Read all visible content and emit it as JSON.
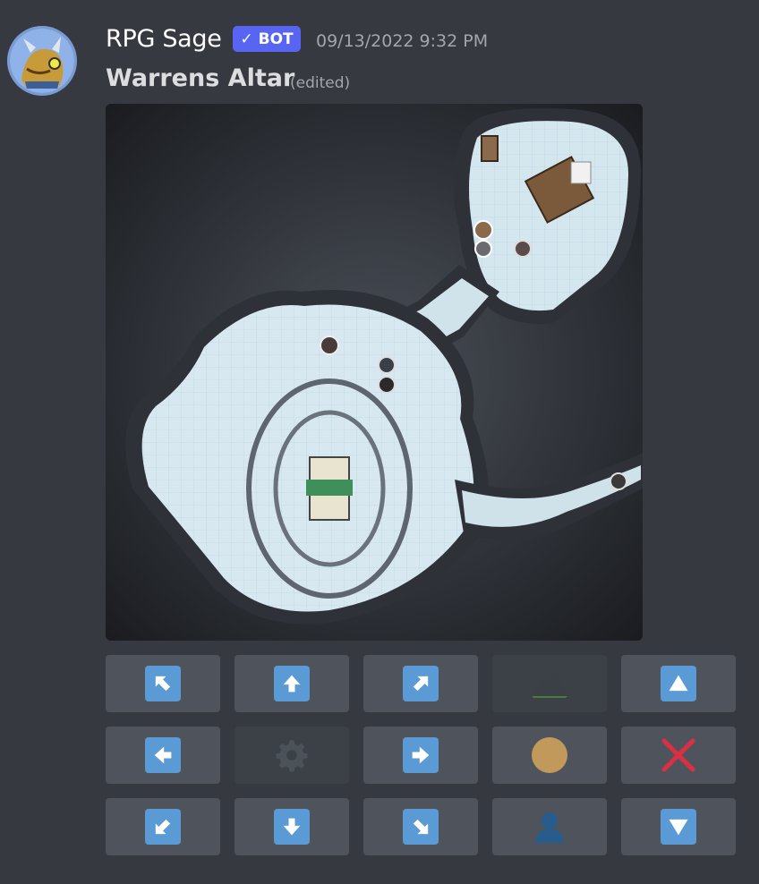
{
  "message": {
    "username": "RPG Sage",
    "bot_tag": "BOT",
    "timestamp": "09/13/2022 9:32 PM",
    "title": "Warrens Altar",
    "edited_label": "(edited)"
  },
  "colors": {
    "bot_tag": "#5865f2",
    "button": "#4f545c",
    "button_disabled": "#3c4047",
    "arrow_box": "#5b9bd5",
    "cancel_red": "#dd2e44",
    "token_circle": "#c19a5b"
  },
  "buttons": [
    {
      "name": "move-up-left-button",
      "icon": "arrow-up-left-icon"
    },
    {
      "name": "move-up-button",
      "icon": "arrow-up-icon"
    },
    {
      "name": "move-up-right-button",
      "icon": "arrow-up-right-icon"
    },
    {
      "name": "terrain-button",
      "icon": "mountain-icon",
      "disabled": true
    },
    {
      "name": "scroll-up-button",
      "icon": "triangle-up-icon"
    },
    {
      "name": "move-left-button",
      "icon": "arrow-left-icon"
    },
    {
      "name": "settings-button",
      "icon": "gear-icon",
      "disabled": true
    },
    {
      "name": "move-right-button",
      "icon": "arrow-right-icon"
    },
    {
      "name": "token-button",
      "icon": "brown-circle-icon"
    },
    {
      "name": "cancel-button",
      "icon": "cross-mark-icon"
    },
    {
      "name": "move-down-left-button",
      "icon": "arrow-down-left-icon"
    },
    {
      "name": "move-down-button",
      "icon": "arrow-down-icon"
    },
    {
      "name": "move-down-right-button",
      "icon": "arrow-down-right-icon"
    },
    {
      "name": "user-button",
      "icon": "person-silhouette-icon"
    },
    {
      "name": "scroll-down-button",
      "icon": "triangle-down-icon"
    }
  ]
}
